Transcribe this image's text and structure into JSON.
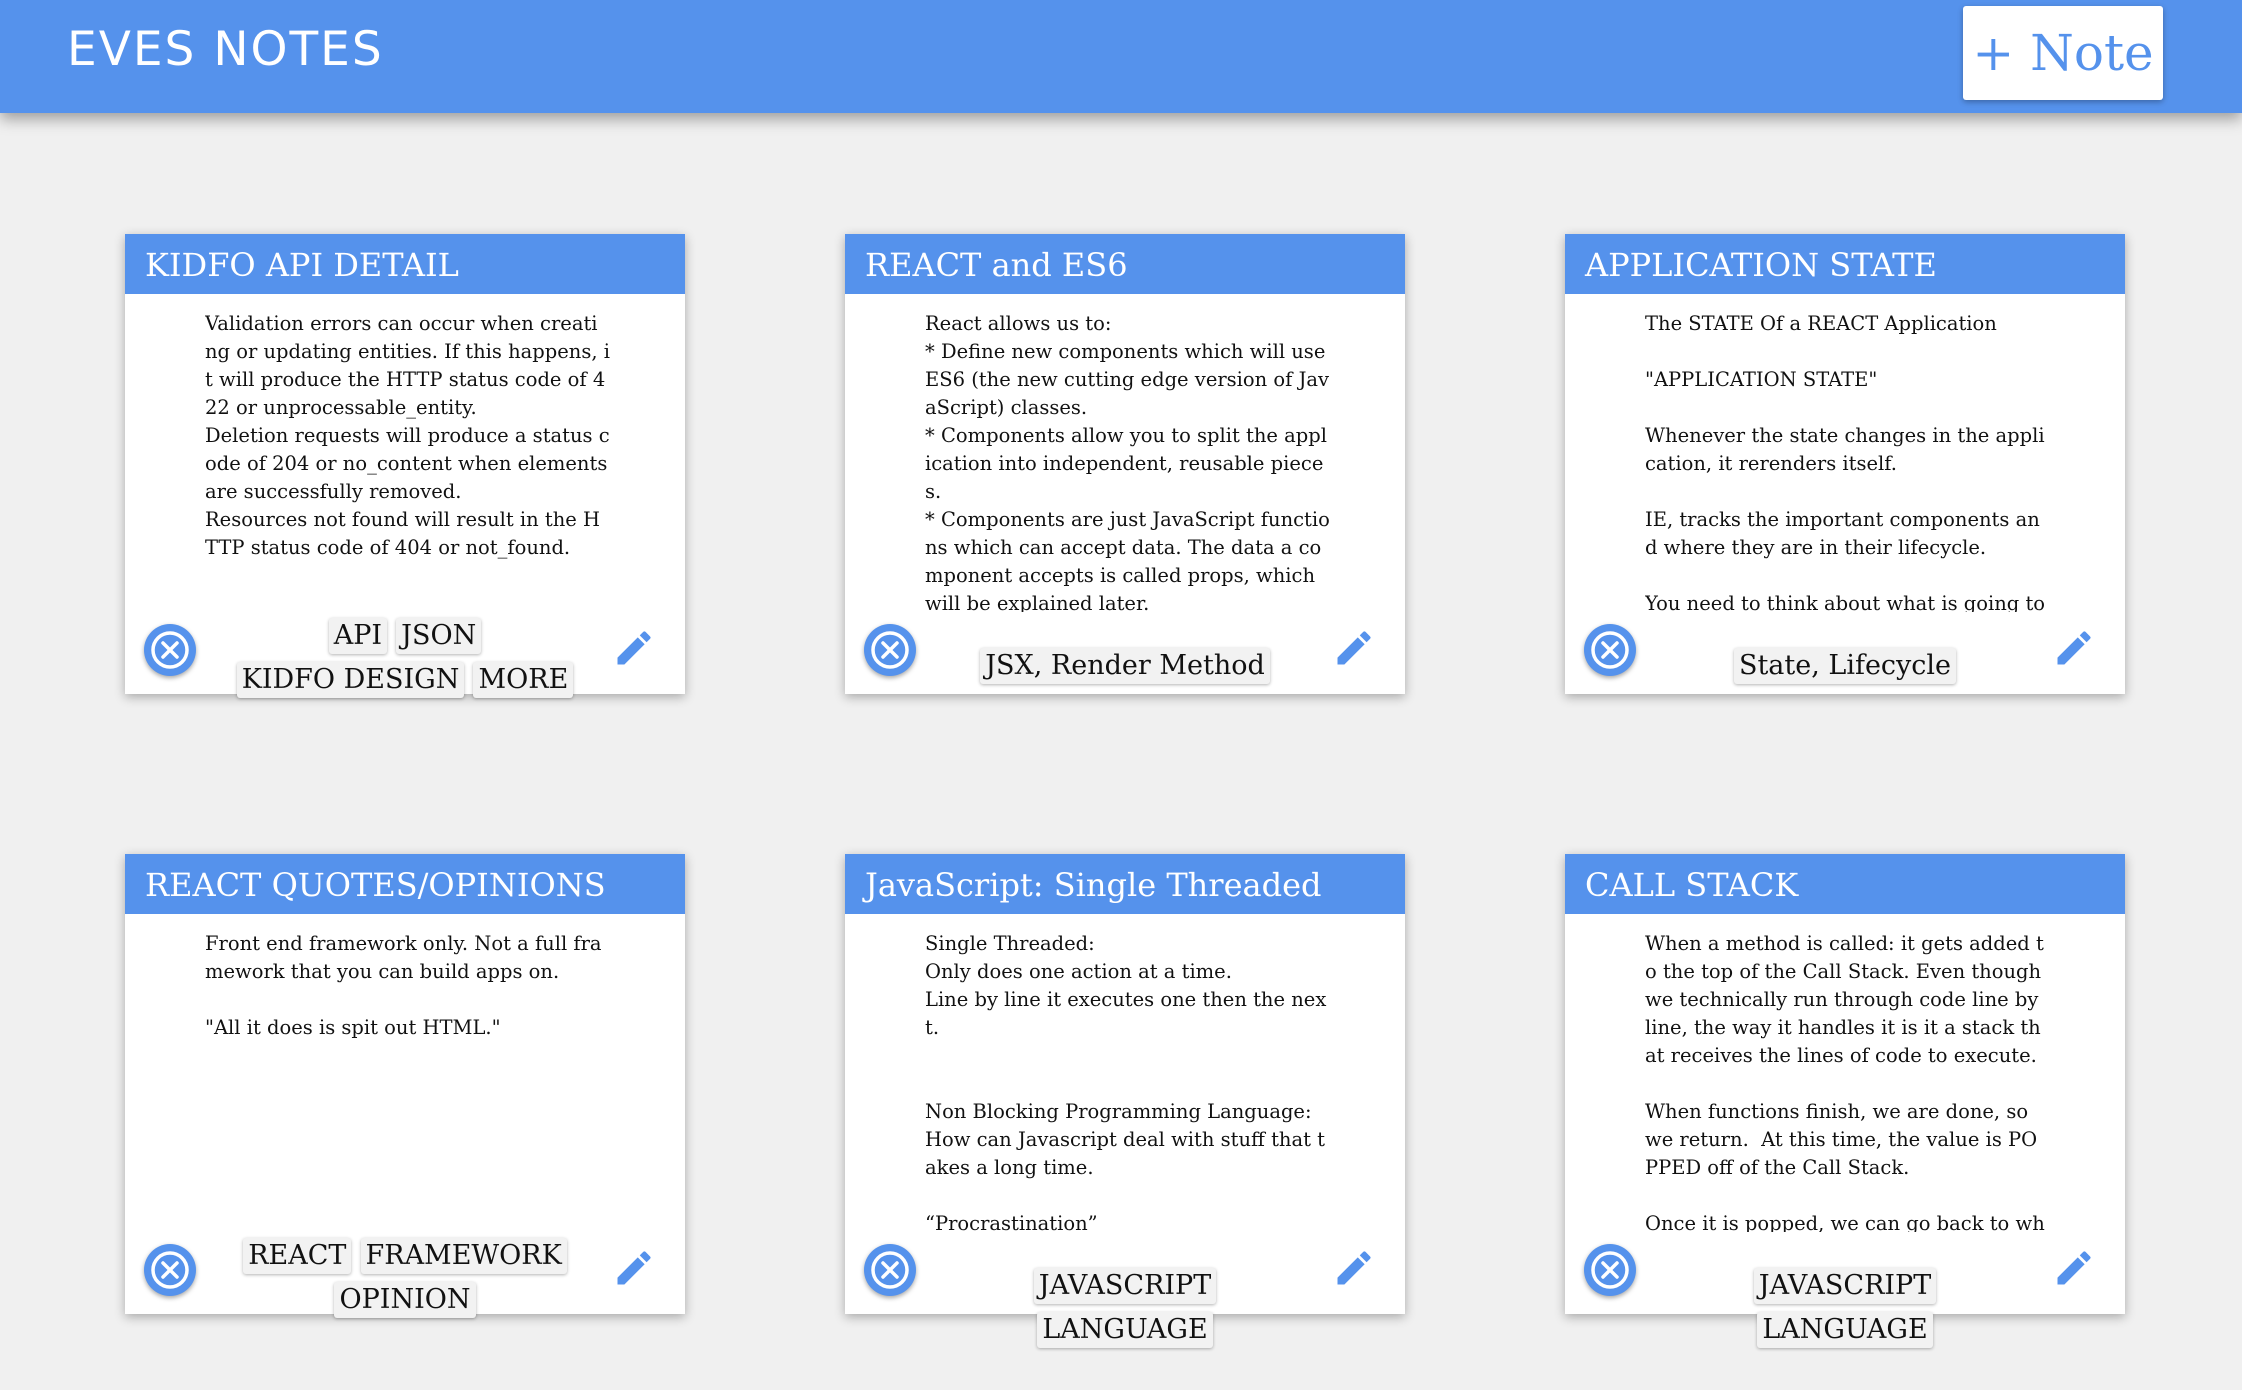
{
  "header": {
    "title": "EVES NOTES",
    "add_label": "+ Note"
  },
  "colors": {
    "primary": "#5592ec",
    "background": "#f0f0f0",
    "card": "#ffffff"
  },
  "icons": {
    "delete": "close-circle-icon",
    "edit": "pencil-icon"
  },
  "notes": [
    {
      "title": "KIDFO API DETAIL",
      "body": "Validation errors can occur when creating or updating entities. If this happens, it will produce the HTTP status code of 422 or unprocessable_entity.\nDeletion requests will produce a status code of 204 or no_content when elements are successfully removed.\nResources not found will result in the HTTP status code of 404 or not_found.",
      "tags": [
        "API",
        "JSON",
        "KIDFO DESIGN",
        "MORE"
      ]
    },
    {
      "title": "REACT and ES6",
      "body": "React allows us to:\n* Define new components which will use ES6 (the new cutting edge version of JavaScript) classes.\n* Components allow you to split the application into independent, reusable pieces.\n* Components are just JavaScript functions which can accept data. The data a component accepts is called props, which will be explained later.\n* Components have a render method, which returns a representation of HTML and a template",
      "tags": [
        "JSX, Render Method"
      ]
    },
    {
      "title": "APPLICATION STATE",
      "body": "The STATE Of a REACT Application\n\n\"APPLICATION STATE\"\n\nWhenever the state changes in the application, it rerenders itself.\n\nIE, tracks the important components and where they are in their lifecycle.\n\nYou need to think about what is going to change on the page.",
      "tags": [
        "State, Lifecycle"
      ]
    },
    {
      "title": "REACT QUOTES/OPINIONS",
      "body": "Front end framework only. Not a full framework that you can build apps on.\n\n\"All it does is spit out HTML.\"",
      "tags": [
        "REACT",
        "FRAMEWORK",
        "OPINION"
      ]
    },
    {
      "title": "JavaScript: Single Threaded",
      "body": "Single Threaded:\nOnly does one action at a time.\nLine by line it executes one then the next.\n\n\nNon Blocking Programming Language:\nHow can Javascript deal with stuff that takes a long time.\n\n“Procrastination”\nStarts to do something and",
      "tags": [
        "JAVASCRIPT",
        "LANGUAGE"
      ]
    },
    {
      "title": "CALL STACK",
      "body": "When a method is called: it gets added to the top of the Call Stack. Even though we technically run through code line by line, the way it handles it is it a stack that receives the lines of code to execute.\n\nWhen functions finish, we are done, so we return.  At this time, the value is POPPED off of the Call Stack.\n\nOnce it is popped, we can go back to where we were in the function that called it.",
      "tags": [
        "JAVASCRIPT",
        "LANGUAGE"
      ]
    }
  ]
}
